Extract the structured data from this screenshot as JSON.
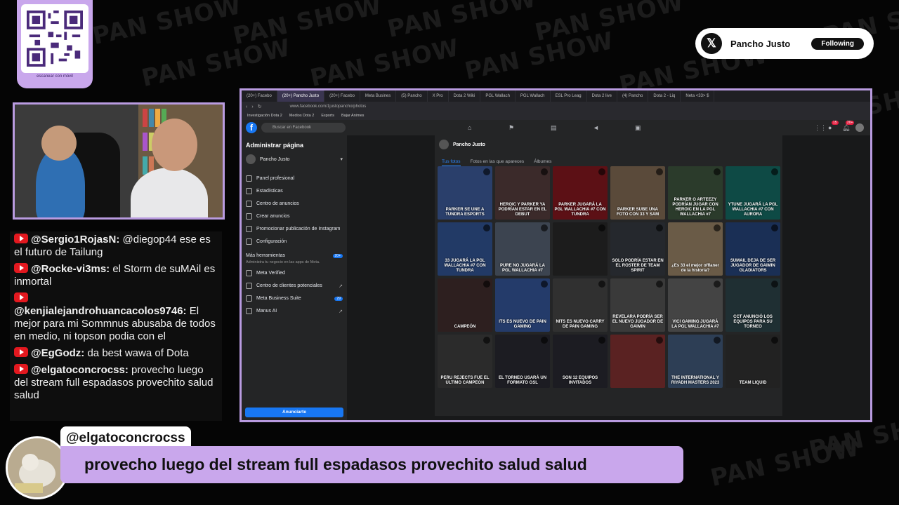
{
  "overlay": {
    "qr_caption": "escanear con móvil",
    "watermark": "PAN SHOW"
  },
  "x_card": {
    "name": "Pancho Justo",
    "follow_label": "Following"
  },
  "chat": [
    {
      "author": "@Sergio1RojasN:",
      "text": "@diegop44 ese es el futuro de Tailung"
    },
    {
      "author": "@Rocke-vi3ms:",
      "text": "el Storm de suMAil es inmortal"
    },
    {
      "author": "@kenjialejandrohuancacolos9746:",
      "text": "El mejor para mi Sommnus abusaba de todos en medio, ni topson podia con el"
    },
    {
      "author": "@EgGodz:",
      "text": "da best wawa of Dota"
    },
    {
      "author": "@elgatoconcrocss:",
      "text": "provecho luego del stream full espadasos provechito salud salud"
    }
  ],
  "browser": {
    "tabs": [
      "(20+) Facebo",
      "(20+) Pancho Justo",
      "(20+) Facebo",
      "Meta Busines",
      "(5) Pancho",
      "X Pro",
      "Dota 2 Wiki",
      "PGL Wallach",
      "PGL Wallach",
      "ESL Pro Leag",
      "Dota 2 live",
      "(4) Pancho",
      "Dota 2 - Liq",
      "Neta <33> $"
    ],
    "url": "www.facebook.com/1justopancho/photos",
    "bookmarks": [
      "Investigación Dota 2",
      "Medios Dota 2",
      "Esports",
      "Bajar Animes"
    ],
    "search_placeholder": "Buscar en Facebook",
    "notif_count": "15",
    "notif_count_2": "20+"
  },
  "sidebar": {
    "title": "Administrar página",
    "page_name": "Pancho Justo",
    "items": [
      "Panel profesional",
      "Estadísticas",
      "Centro de anuncios",
      "Crear anuncios",
      "Promocionar publicación de Instagram",
      "Configuración"
    ],
    "more_tools": "Más herramientas",
    "more_tools_badge": "20+",
    "more_tools_sub": "Administra tu negocio en las apps de Meta.",
    "tools": [
      {
        "label": "Meta Verified",
        "badge": ""
      },
      {
        "label": "Centro de clientes potenciales",
        "badge": ""
      },
      {
        "label": "Meta Business Suite",
        "badge": "29"
      },
      {
        "label": "Manus AI",
        "badge": ""
      }
    ],
    "cta": "Anunciarte"
  },
  "profile": {
    "name": "Pancho Justo",
    "tabs": [
      "Tus fotos",
      "Fotos en las que apareces",
      "Álbumes"
    ]
  },
  "photos": [
    {
      "caption": "PARKER SE UNE A TUNDRA ESPORTS",
      "color": "#2a3f6b"
    },
    {
      "caption": "HEROIC Y PARKER YA PODRÍAN ESTAR EN EL DEBUT",
      "color": "#3b2a2a"
    },
    {
      "caption": "PARKER JUGARÁ LA PGL WALLACHIA #7 CON TUNDRA",
      "color": "#5c1015"
    },
    {
      "caption": "PARKER SUBE UNA FOTO CON 33 Y SAM",
      "color": "#5a4a3a"
    },
    {
      "caption": "PARKER O ARTEEZY PODRÍAN JUGAR CON HEROIC EN LA PGL WALLACHIA #7",
      "color": "#2b3b2b"
    },
    {
      "caption": "YTUNE JUGARÁ LA PGL WALLACHIA #7 CON AURORA",
      "color": "#0e4a45"
    },
    {
      "caption": "33 JUGARÁ LA PGL WALLACHIA #7 CON TUNDRA",
      "color": "#223a66"
    },
    {
      "caption": "PURE NO JUGARÁ LA PGL WALLACHIA #7",
      "color": "#3c4450"
    },
    {
      "caption": "",
      "color": "#1c1c1c"
    },
    {
      "caption": "SOLO PODRÍA ESTAR EN EL ROSTER DE TEAM SPIRIT",
      "color": "#25282d"
    },
    {
      "caption": "¿Es 33 el mejor offlaner de la historia?",
      "color": "#6a5b47"
    },
    {
      "caption": "SUMAIL DEJA DE SER JUGADOR DE GAIMIN GLADIATORS",
      "color": "#1a2f55"
    },
    {
      "caption": "CAMPEÓN",
      "color": "#2d1f1f"
    },
    {
      "caption": "ITS ES NUEVO DE PAIN GAMING",
      "color": "#243b6a"
    },
    {
      "caption": "NITS ES NUEVO CARRY DE PAIN GAMING",
      "color": "#303030"
    },
    {
      "caption": "REVELARA PODRÍA SER EL NUEVO JUGADOR DE GAIMIN",
      "color": "#3a3a3a"
    },
    {
      "caption": "VICI GAMING JUGARÁ LA PGL WALLACHIA #7",
      "color": "#444"
    },
    {
      "caption": "CCT ANUNCIÓ LOS EQUIPOS PARA SU TORNEO",
      "color": "#1f2f33"
    },
    {
      "caption": "PERU REJECTS FUE EL ÚLTIMO CAMPEÓN",
      "color": "#2b2b2b"
    },
    {
      "caption": "EL TORNEO USARÁ UN FORMATO GSL",
      "color": "#1c1c22"
    },
    {
      "caption": "SON 12 EQUIPOS INVITADOS",
      "color": "#1c1c22"
    },
    {
      "caption": "",
      "color": "#5a2222"
    },
    {
      "caption": "THE INTERNATIONAL Y RIYADH MASTERS 2023",
      "color": "#2d3e55"
    },
    {
      "caption": "TEAM LIQUID",
      "color": "#222"
    }
  ],
  "banner": {
    "author": "@elgatoconcrocss",
    "message": "provecho luego del stream full espadasos provechito salud salud"
  }
}
